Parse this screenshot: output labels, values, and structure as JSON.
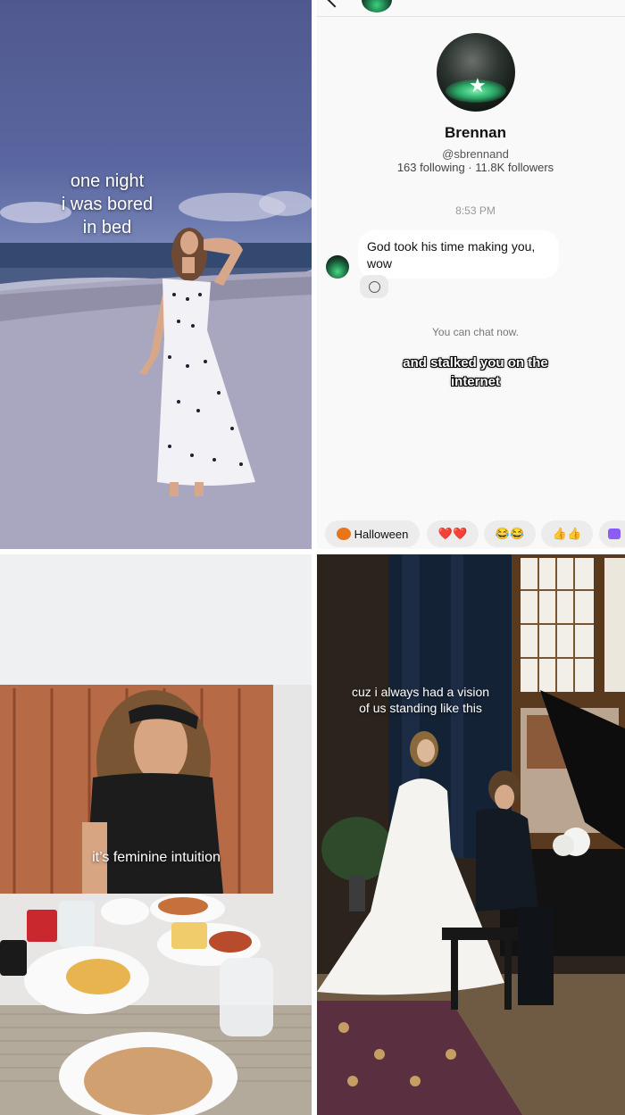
{
  "panel1": {
    "caption": "one night\ni was bored\nin bed"
  },
  "panel2": {
    "profile": {
      "name": "Brennan",
      "handle": "@sbrennand",
      "stats": "163 following · 11.8K followers"
    },
    "timestamp": "8:53 PM",
    "message": "God took his time making you,\nwow",
    "system_note": "You can chat now.",
    "overlay": "and stalked you on the\ninternet",
    "chips": [
      {
        "icon": "pumpkin-icon",
        "label": "Halloween"
      },
      {
        "icon": "hearts-emoji",
        "label": "❤️❤️"
      },
      {
        "icon": "laugh-emoji",
        "label": "😂😂"
      },
      {
        "icon": "thumbs-emoji",
        "label": "👍👍"
      }
    ]
  },
  "panel3": {
    "caption": "it’s feminine intuition"
  },
  "panel4": {
    "caption": "cuz i always had a vision\nof us standing like this"
  }
}
